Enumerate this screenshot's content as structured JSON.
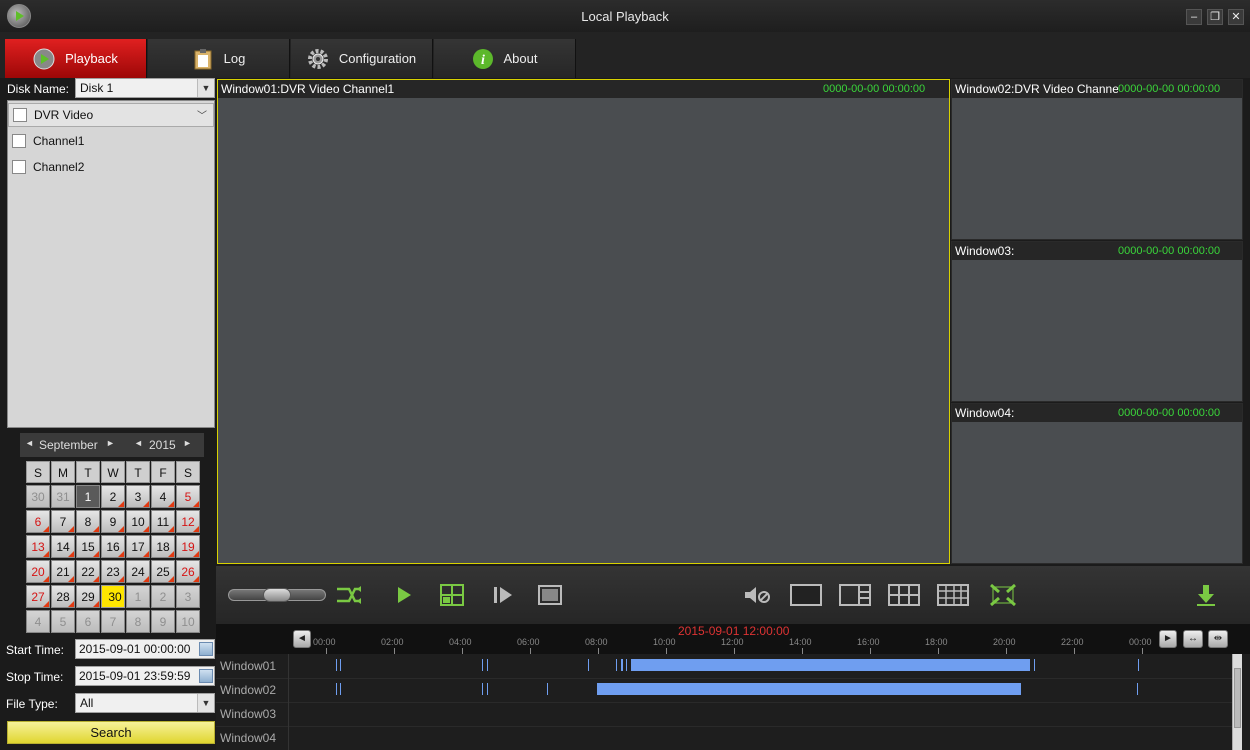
{
  "window": {
    "title": "Local Playback",
    "min_label": "–",
    "max_label": "❐",
    "close_label": "✕"
  },
  "tabs": [
    {
      "label": "Playback",
      "icon": "playback-icon",
      "active": true
    },
    {
      "label": "Log",
      "icon": "log-clipboard-icon",
      "active": false
    },
    {
      "label": "Configuration",
      "icon": "gear-icon",
      "active": false
    },
    {
      "label": "About",
      "icon": "info-icon",
      "active": false
    }
  ],
  "sidebar": {
    "disk_label": "Disk Name:",
    "disk_value": "Disk 1",
    "group": {
      "label": "DVR Video"
    },
    "channels": [
      {
        "label": "Channel1"
      },
      {
        "label": "Channel2"
      }
    ],
    "calendar": {
      "month": "September",
      "year": "2015",
      "prev_month": "◄",
      "next_month": "►",
      "prev_year": "◄",
      "next_year": "►",
      "weekdays": [
        "S",
        "M",
        "T",
        "W",
        "T",
        "F",
        "S"
      ],
      "days": [
        {
          "d": "30",
          "state": "gray"
        },
        {
          "d": "31",
          "state": "gray"
        },
        {
          "d": "1",
          "state": "today"
        },
        {
          "d": "2",
          "state": "rec"
        },
        {
          "d": "3",
          "state": "rec"
        },
        {
          "d": "4",
          "state": "rec"
        },
        {
          "d": "5",
          "state": "red rec"
        },
        {
          "d": "6",
          "state": "red rec"
        },
        {
          "d": "7",
          "state": "rec"
        },
        {
          "d": "8",
          "state": "rec"
        },
        {
          "d": "9",
          "state": "rec"
        },
        {
          "d": "10",
          "state": "rec"
        },
        {
          "d": "11",
          "state": "rec"
        },
        {
          "d": "12",
          "state": "red rec"
        },
        {
          "d": "13",
          "state": "red rec"
        },
        {
          "d": "14",
          "state": "rec"
        },
        {
          "d": "15",
          "state": "rec"
        },
        {
          "d": "16",
          "state": "rec"
        },
        {
          "d": "17",
          "state": "rec"
        },
        {
          "d": "18",
          "state": "rec"
        },
        {
          "d": "19",
          "state": "red rec"
        },
        {
          "d": "20",
          "state": "red rec"
        },
        {
          "d": "21",
          "state": "rec"
        },
        {
          "d": "22",
          "state": "rec"
        },
        {
          "d": "23",
          "state": "rec"
        },
        {
          "d": "24",
          "state": "rec"
        },
        {
          "d": "25",
          "state": "rec"
        },
        {
          "d": "26",
          "state": "red rec"
        },
        {
          "d": "27",
          "state": "red rec"
        },
        {
          "d": "28",
          "state": "rec"
        },
        {
          "d": "29",
          "state": "rec"
        },
        {
          "d": "30",
          "state": "sel"
        },
        {
          "d": "1",
          "state": "gray"
        },
        {
          "d": "2",
          "state": "gray"
        },
        {
          "d": "3",
          "state": "gray"
        },
        {
          "d": "4",
          "state": "gray"
        },
        {
          "d": "5",
          "state": "gray"
        },
        {
          "d": "6",
          "state": "gray"
        },
        {
          "d": "7",
          "state": "gray"
        },
        {
          "d": "8",
          "state": "gray"
        },
        {
          "d": "9",
          "state": "gray"
        },
        {
          "d": "10",
          "state": "gray"
        }
      ]
    },
    "start_label": "Start Time:",
    "start_value": "2015-09-01 00:00:00",
    "stop_label": "Stop Time:",
    "stop_value": "2015-09-01 23:59:59",
    "filetype_label": "File Type:",
    "filetype_value": "All",
    "search_label": "Search"
  },
  "video": {
    "main": {
      "title": "Window01:DVR Video Channel1",
      "time": "0000-00-00 00:00:00"
    },
    "side": [
      {
        "title": "Window02:DVR Video Channe",
        "time": "0000-00-00 00:00:00"
      },
      {
        "title": "Window03:",
        "time": "0000-00-00 00:00:00"
      },
      {
        "title": "Window04:",
        "time": "0000-00-00 00:00:00"
      }
    ]
  },
  "colors": {
    "accent_red": "#c30d0d",
    "timeline_bar": "#6f9ef0",
    "time_green": "#3ad63a",
    "button_green": "#7ac943"
  },
  "timeline": {
    "current": "2015-09-01 12:00:00",
    "ticks": [
      "00:00",
      "02:00",
      "04:00",
      "06:00",
      "08:00",
      "10:00",
      "12:00",
      "14:00",
      "16:00",
      "18:00",
      "20:00",
      "22:00",
      "00:00"
    ],
    "rows": [
      "Window01",
      "Window02",
      "Window03",
      "Window04"
    ]
  }
}
